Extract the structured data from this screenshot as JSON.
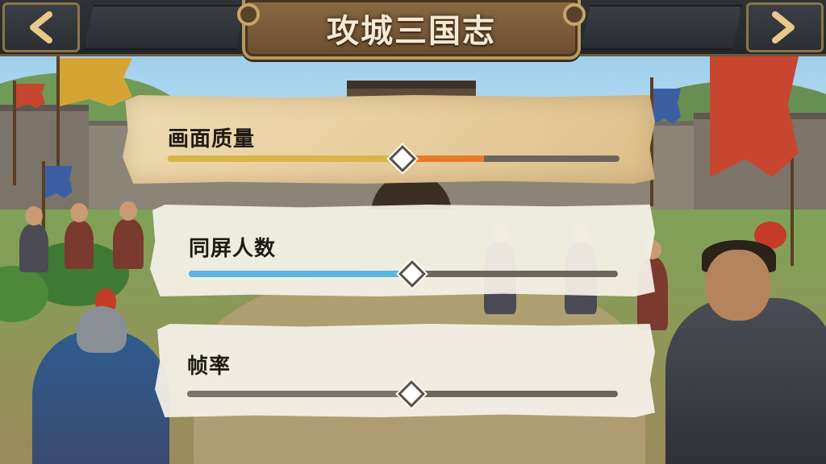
{
  "header": {
    "title": "攻城三国志",
    "back_icon": "chevron-left-icon",
    "close_icon": "chevron-right-icon"
  },
  "settings": [
    {
      "label": "画面质量",
      "value": 0.52,
      "fill_color": "#d9b545",
      "extra_color": "#e77a2a",
      "extra_end": 0.7
    },
    {
      "label": "同屏人数",
      "value": 0.52,
      "fill_color": "#5ab6e2"
    },
    {
      "label": "帧率",
      "value": 0.52,
      "fill_color": "#7b746b"
    }
  ]
}
